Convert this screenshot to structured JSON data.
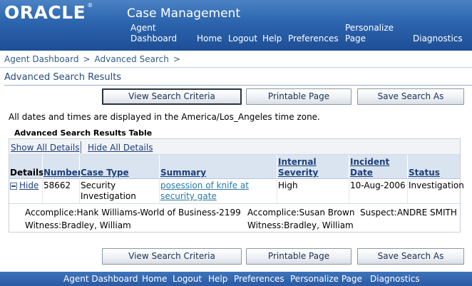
{
  "header": {
    "brand": "ORACLE",
    "brand_mark": "®",
    "app_title": "Case Management",
    "nav": {
      "agent_dashboard_l1": "Agent",
      "agent_dashboard_l2": "Dashboard",
      "home": "Home",
      "logout": "Logout",
      "help": "Help",
      "preferences": "Preferences",
      "personalize_l1": "Personalize",
      "personalize_l2": "Page",
      "diagnostics": "Diagnostics"
    }
  },
  "breadcrumb": {
    "items": [
      "Agent Dashboard",
      "Advanced Search"
    ],
    "separator": ">"
  },
  "page_title": "Advanced Search Results",
  "buttons": {
    "view_criteria": "View Search Criteria",
    "printable": "Printable Page",
    "save_search": "Save Search As"
  },
  "timezone_note": "All dates and times are displayed in the America/Los_Angeles time zone.",
  "table": {
    "title": "Advanced Search Results Table",
    "show_all": "Show All Details",
    "hide_all": "Hide All Details",
    "columns": {
      "details": "Details",
      "number": "Number",
      "case_type": "Case Type",
      "summary": "Summary",
      "severity_l1": "Internal",
      "severity_l2": "Severity",
      "incident_l1": "Incident",
      "incident_l2": "Date",
      "status": "Status"
    },
    "row": {
      "toggle": "Hide",
      "number": "58662",
      "case_type_l1": "Security",
      "case_type_l2": "Investigation",
      "summary_l1": "posession of knife at",
      "summary_l2": "security gate",
      "severity": "High",
      "incident_date": "10-Aug-2006",
      "status": "Investigation"
    },
    "details": {
      "accomplice_1": "Accomplice:Hank Williams-World of Business-2199",
      "accomplice_2": "Accomplice:Susan Brown",
      "suspect": "Suspect:ANDRE SMITH",
      "witness_1": "Witness:Bradley, William",
      "witness_2": "Witness:Bradley, William"
    }
  },
  "footer": {
    "agent_dashboard": "Agent Dashboard",
    "home": "Home",
    "logout": "Logout",
    "help": "Help",
    "preferences": "Preferences",
    "personalize": "Personalize Page",
    "diagnostics": "Diagnostics"
  }
}
